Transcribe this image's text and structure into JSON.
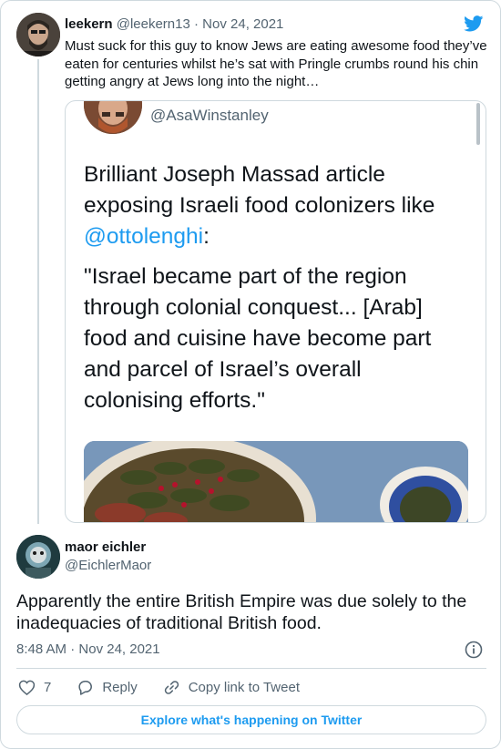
{
  "parent_tweet": {
    "name": "leekern",
    "handle": "@leekern13",
    "date": "Nov 24, 2021",
    "text": "Must suck for this guy to know Jews are eating awesome food they’ve eaten for centuries whilst he’s sat with Pringle crumbs round his chin getting angry at Jews long into the night…",
    "embedded": {
      "handle": "@AsaWinstanley",
      "text_before": "Brilliant Joseph Massad article exposing Israeli food colonizers like ",
      "mention": "@ottolenghi",
      "text_after": ":",
      "quote": "\"Israel became part of the region through colonial conquest... [Arab] food and cuisine have become part and parcel of Israel’s overall colonising efforts.\""
    }
  },
  "main_tweet": {
    "name": "maor eichler",
    "handle": "@EichlerMaor",
    "text": "Apparently the entire British Empire was due solely to the inadequacies of traditional British food.",
    "time": "8:48 AM",
    "date": "Nov 24, 2021",
    "dot": "·"
  },
  "actions": {
    "like_count": "7",
    "reply_label": "Reply",
    "copy_label": "Copy link to Tweet"
  },
  "explore_label": "Explore what's happening on Twitter",
  "icons": {
    "brand": "twitter-bird-icon",
    "info": "info-icon",
    "like": "heart-icon",
    "reply": "speech-bubble-icon",
    "copy": "link-icon"
  },
  "colors": {
    "accent": "#1d9bf0",
    "text": "#0f1419",
    "secondary": "#536471",
    "border": "#cfd9de"
  }
}
